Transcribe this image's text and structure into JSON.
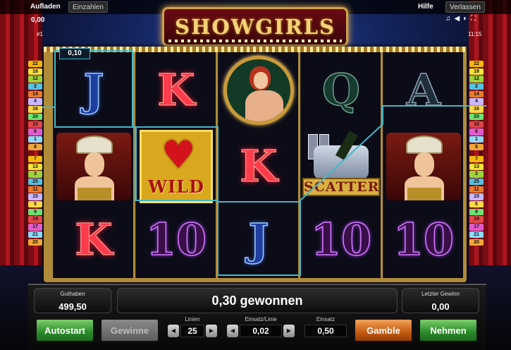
{
  "topbar": {
    "tab_aufladen": "Aufladen",
    "tab_einzahlen": "Einzahlen",
    "tab_hilfe": "Hilfe",
    "tab_verlassen": "Verlassen",
    "credit": "0,00",
    "hash": "#1",
    "clock": "11:15",
    "icons": [
      "music-icon",
      "speaker-icon",
      "sound-toggle-icon",
      "fullscreen-icon"
    ]
  },
  "logo": {
    "text": "SHOWGIRLS"
  },
  "reels": [
    [
      "J",
      "showgirl",
      "K"
    ],
    [
      "K",
      "WILD",
      "10"
    ],
    [
      "medallion-girl",
      "K",
      "J"
    ],
    [
      "Q",
      "SCATTER",
      "10"
    ],
    [
      "A",
      "showgirl",
      "10"
    ]
  ],
  "win_line_label": "0,10",
  "lines_left": [
    "22",
    "18",
    "12",
    "2",
    "14",
    "4",
    "16",
    "20",
    "10",
    "6",
    "1",
    "8",
    "7",
    "13",
    "3",
    "25",
    "11",
    "15",
    "5",
    "9",
    "19",
    "17",
    "21",
    "20"
  ],
  "lines_right": [
    "22",
    "18",
    "12",
    "2",
    "14",
    "4",
    "16",
    "20",
    "10",
    "6",
    "1",
    "8",
    "7",
    "13",
    "3",
    "25",
    "11",
    "15",
    "5",
    "9",
    "19",
    "17",
    "21",
    "20"
  ],
  "panel": {
    "guthaben_label": "Guthaben",
    "guthaben_value": "499,50",
    "message": "0,30 gewonnen",
    "letzter_label": "Letzter Gewinn",
    "letzter_value": "0,00",
    "autostart": "Autostart",
    "gewinne": "Gewinne",
    "linien_label": "Linien",
    "linien_value": "25",
    "einsatz_linie_label": "Einsatz/Linie",
    "einsatz_linie_value": "0,02",
    "einsatz_label": "Einsatz",
    "einsatz_value": "0,50",
    "gamble": "Gamble",
    "nehmen": "Nehmen"
  },
  "colors": {
    "accent_cyan": "#44b8c8",
    "button_green": "#2a8a2a",
    "button_orange": "#c45a10",
    "logo_gold": "#f6d27a"
  }
}
